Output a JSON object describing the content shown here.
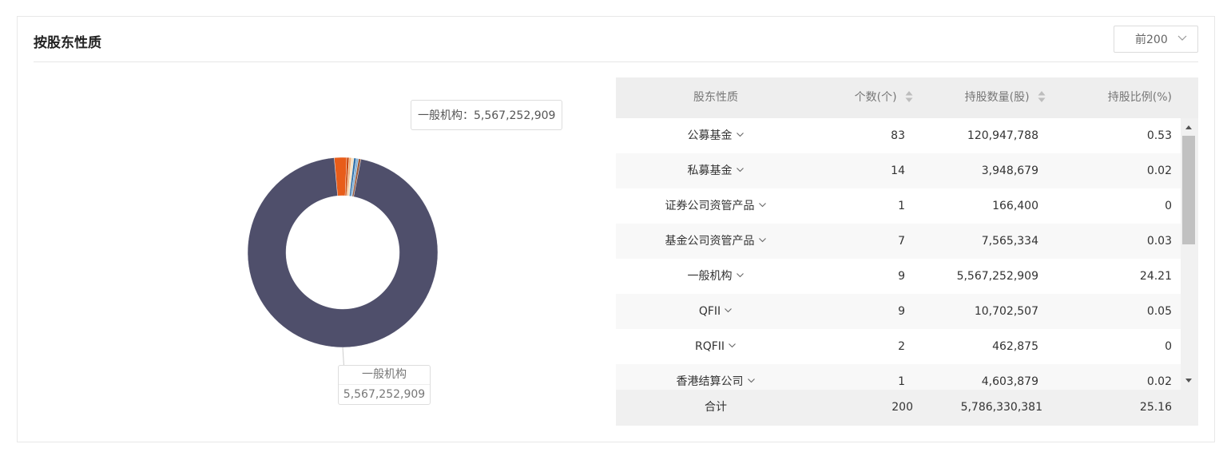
{
  "title": "按股东性质",
  "top_select": {
    "value": "前200"
  },
  "tooltip": {
    "text": "一般机构：5,567,252,909"
  },
  "callout": {
    "name": "一般机构",
    "value": "5,567,252,909"
  },
  "table": {
    "headers": {
      "nature": "股东性质",
      "count": "个数(个)",
      "shares": "持股数量(股)",
      "ratio": "持股比例(%)"
    },
    "rows": [
      {
        "nature": "公募基金",
        "count": "83",
        "shares": "120,947,788",
        "ratio": "0.53"
      },
      {
        "nature": "私募基金",
        "count": "14",
        "shares": "3,948,679",
        "ratio": "0.02"
      },
      {
        "nature": "证券公司资管产品",
        "count": "1",
        "shares": "166,400",
        "ratio": "0"
      },
      {
        "nature": "基金公司资管产品",
        "count": "7",
        "shares": "7,565,334",
        "ratio": "0.03"
      },
      {
        "nature": "一般机构",
        "count": "9",
        "shares": "5,567,252,909",
        "ratio": "24.21"
      },
      {
        "nature": "QFII",
        "count": "9",
        "shares": "10,702,507",
        "ratio": "0.05"
      },
      {
        "nature": "RQFII",
        "count": "2",
        "shares": "462,875",
        "ratio": "0"
      },
      {
        "nature": "香港结算公司",
        "count": "1",
        "shares": "4,603,879",
        "ratio": "0.02"
      }
    ],
    "total": {
      "label": "合计",
      "count": "200",
      "shares": "5,786,330,381",
      "ratio": "25.16"
    }
  },
  "chart_data": {
    "type": "pie",
    "style": "donut",
    "slices": [
      {
        "label": "一般机构",
        "value": 5567252909,
        "color": "#4f4f6b"
      },
      {
        "label": "公募基金",
        "value": 120947788,
        "color": "#e85d1a"
      },
      {
        "label": "QFII",
        "value": 10702507,
        "color": "#c94a12"
      },
      {
        "label": "基金公司资管产品",
        "value": 7565334,
        "color": "#f0b27a"
      },
      {
        "label": "香港结算公司",
        "value": 4603879,
        "color": "#f7e3c4"
      },
      {
        "label": "私募基金",
        "value": 3948679,
        "color": "#2f6fa8"
      },
      {
        "label": "RQFII",
        "value": 462875,
        "color": "#7fb0d8"
      },
      {
        "label": "证券公司资管产品",
        "value": 166400,
        "color": "#9c5a3a"
      }
    ],
    "hovered": "一般机构"
  }
}
